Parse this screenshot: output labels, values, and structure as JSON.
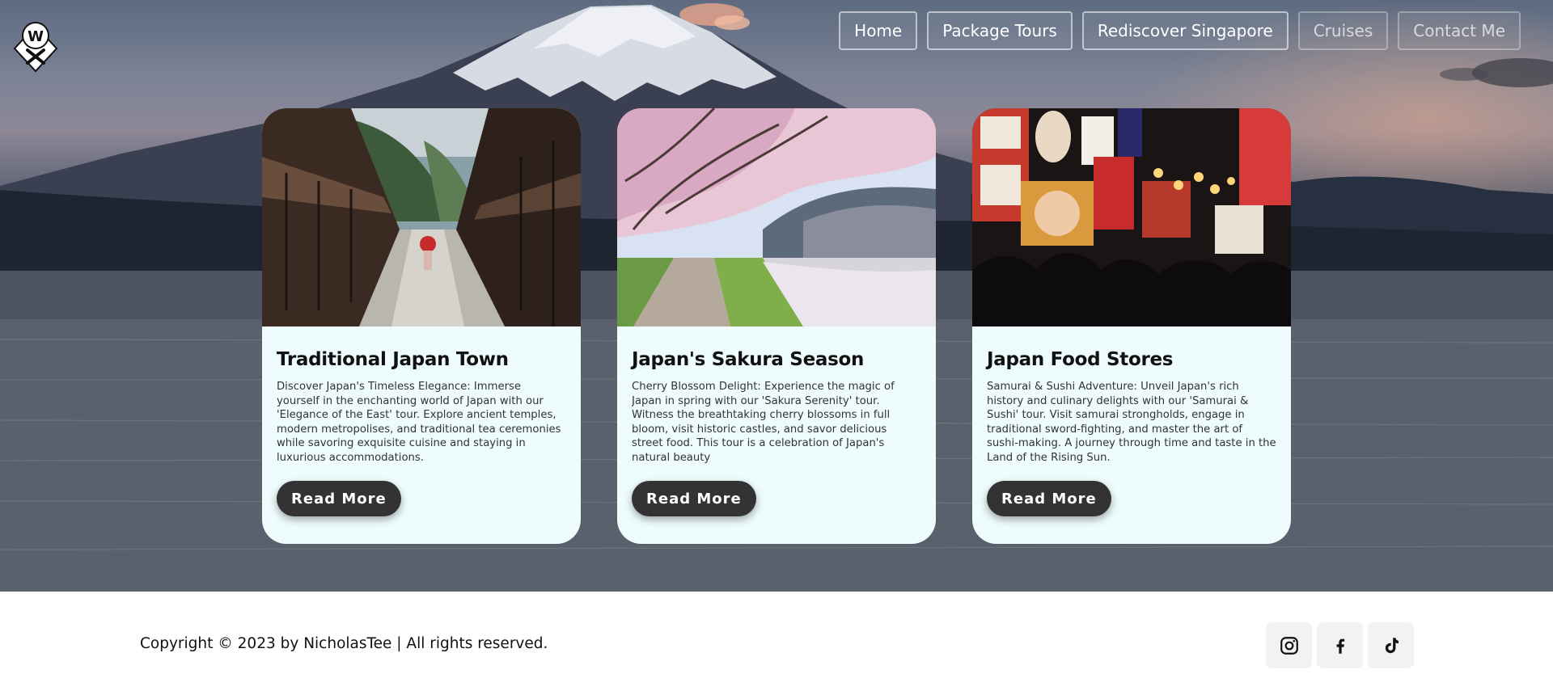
{
  "logo": {
    "letter": "W",
    "icon": "wx-diamond-logo"
  },
  "nav": {
    "items": [
      {
        "label": "Home"
      },
      {
        "label": "Package Tours"
      },
      {
        "label": "Rediscover Singapore"
      },
      {
        "label": "Cruises"
      },
      {
        "label": "Contact Me"
      }
    ]
  },
  "cards": [
    {
      "title": "Traditional Japan Town",
      "text": "Discover Japan's Timeless Elegance: Immerse yourself in the enchanting world of Japan with our 'Elegance of the East' tour. Explore ancient temples, modern metropolises, and traditional tea ceremonies while savoring exquisite cuisine and staying in luxurious accommodations.",
      "button": "Read More",
      "image": "traditional-town-street-photo"
    },
    {
      "title": "Japan's Sakura Season",
      "text": "Cherry Blossom Delight: Experience the magic of Japan in spring with our 'Sakura Serenity' tour. Witness the breathtaking cherry blossoms in full bloom, visit historic castles, and savor delicious street food. This tour is a celebration of Japan's natural beauty",
      "button": "Read More",
      "image": "cherry-blossom-path-photo"
    },
    {
      "title": "Japan Food Stores",
      "text": "Samurai & Sushi Adventure: Unveil Japan's rich history and culinary delights with our 'Samurai & Sushi' tour. Visit samurai strongholds, engage in traditional sword-fighting, and master the art of sushi-making. A journey through time and taste in the Land of the Rising Sun.",
      "button": "Read More",
      "image": "night-food-street-photo"
    }
  ],
  "footer": {
    "copyright": "Copyright © 2023 by NicholasTee | All rights reserved.",
    "socials": [
      {
        "icon": "instagram-icon"
      },
      {
        "icon": "facebook-icon"
      },
      {
        "icon": "tiktok-icon"
      }
    ]
  },
  "colors": {
    "card_bg": "#eefcfd",
    "button_bg": "#333333",
    "button_text": "#ffffff",
    "social_bg": "#f2f2f2"
  }
}
